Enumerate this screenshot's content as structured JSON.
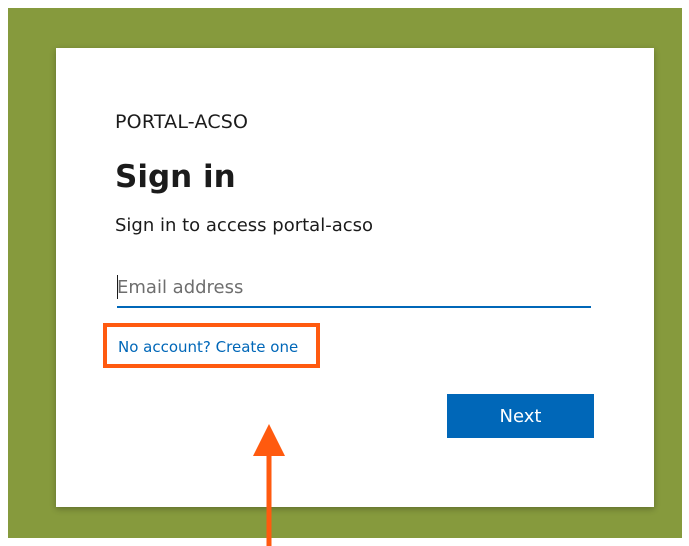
{
  "signin": {
    "org_name": "PORTAL-ACSO",
    "title": "Sign in",
    "subtitle": "Sign in to access portal-acso",
    "email_placeholder": "Email address",
    "email_value": "",
    "create_account_link": "No account? Create one",
    "next_button": "Next"
  },
  "colors": {
    "backdrop": "#869A3D",
    "accent": "#0067b8",
    "annotation": "#FF5A0F"
  },
  "annotation": {
    "highlight": "create-account-link",
    "arrow_direction": "up"
  }
}
